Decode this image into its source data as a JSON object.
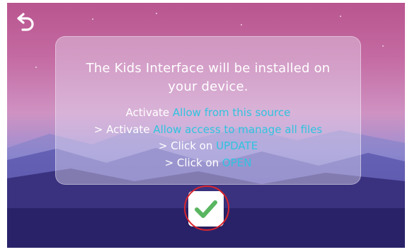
{
  "dialog": {
    "title": "The Kids Interface will be installed on your device.",
    "steps": [
      {
        "prefix": "Activate ",
        "highlight": "Allow from this source"
      },
      {
        "prefix": "> Activate ",
        "highlight": "Allow access to manage all files"
      },
      {
        "prefix": "> Click on ",
        "highlight": "UPDATE"
      },
      {
        "prefix": "> Click on ",
        "highlight": "OPEN"
      }
    ]
  },
  "icons": {
    "back": "back-arrow-icon",
    "confirm": "checkmark-icon"
  },
  "colors": {
    "accent_text": "#2fc3df",
    "check_green": "#59b560",
    "highlight_ring": "#d8252e"
  }
}
